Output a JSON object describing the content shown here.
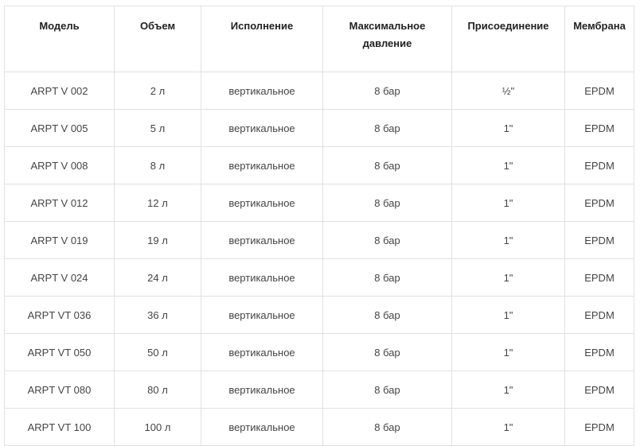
{
  "table": {
    "headers": [
      "Модель",
      "Объем",
      "Исполнение",
      "Максимальное давление",
      "Присоединение",
      "Мембрана"
    ],
    "rows": [
      [
        "ARPT V 002",
        "2 л",
        "вертикальное",
        "8 бар",
        "½\"",
        "EPDM"
      ],
      [
        "ARPT V 005",
        "5 л",
        "вертикальное",
        "8 бар",
        "1\"",
        "EPDM"
      ],
      [
        "ARPT V 008",
        "8 л",
        "вертикальное",
        "8 бар",
        "1\"",
        "EPDM"
      ],
      [
        "ARPT V 012",
        "12 л",
        "вертикальное",
        "8 бар",
        "1\"",
        "EPDM"
      ],
      [
        "ARPT V 019",
        "19 л",
        "вертикальное",
        "8 бар",
        "1\"",
        "EPDM"
      ],
      [
        "ARPT V 024",
        "24 л",
        "вертикальное",
        "8 бар",
        "1\"",
        "EPDM"
      ],
      [
        "ARPT VT 036",
        "36 л",
        "вертикальное",
        "8 бар",
        "1\"",
        "EPDM"
      ],
      [
        "ARPT VT 050",
        "50 л",
        "вертикальное",
        "8 бар",
        "1\"",
        "EPDM"
      ],
      [
        "ARPT VT 080",
        "80 л",
        "вертикальное",
        "8 бар",
        "1\"",
        "EPDM"
      ],
      [
        "ARPT VT 100",
        "100 л",
        "вертикальное",
        "8 бар",
        "1\"",
        "EPDM"
      ]
    ]
  }
}
